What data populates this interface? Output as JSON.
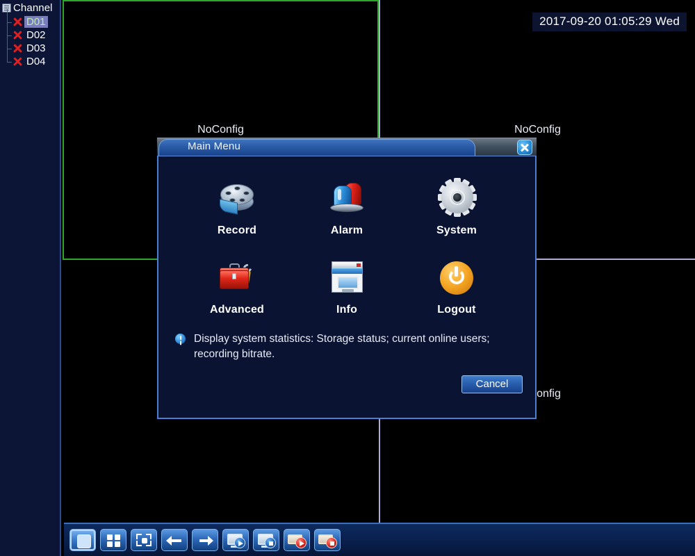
{
  "sidebar": {
    "header_label": "Channel",
    "header_icon": "tree-node-icon",
    "channels": [
      {
        "label": "D01",
        "status_icon": "red-x-icon",
        "selected": true
      },
      {
        "label": "D02",
        "status_icon": "red-x-icon",
        "selected": false
      },
      {
        "label": "D03",
        "status_icon": "red-x-icon",
        "selected": false
      },
      {
        "label": "D04",
        "status_icon": "red-x-icon",
        "selected": false
      }
    ]
  },
  "wall": {
    "osd_timestamp": "2017-09-20 01:05:29 Wed",
    "panes": [
      {
        "id": "pane-1",
        "status_text": "NoConfig",
        "selected": true
      },
      {
        "id": "pane-2",
        "status_text": "NoConfig",
        "selected": false
      },
      {
        "id": "pane-3",
        "status_text": "",
        "selected": false
      },
      {
        "id": "pane-4",
        "status_text": "NoConfig",
        "selected": false
      }
    ],
    "selection_color": "#2aa82a",
    "divider_color": "#b6a8d8"
  },
  "dialog": {
    "title": "Main Menu",
    "close_label": "✕",
    "items": [
      {
        "label": "Record",
        "icon": "film-reel-icon"
      },
      {
        "label": "Alarm",
        "icon": "siren-icon"
      },
      {
        "label": "System",
        "icon": "gear-icon"
      },
      {
        "label": "Advanced",
        "icon": "toolbox-icon"
      },
      {
        "label": "Info",
        "icon": "monitor-window-icon"
      },
      {
        "label": "Logout",
        "icon": "power-icon"
      }
    ],
    "hint_icon": "info-icon",
    "hint_text": "Display system statistics: Storage status; current online users; recording bitrate.",
    "cancel_label": "Cancel"
  },
  "taskbar": {
    "buttons": [
      {
        "name": "single-view-button",
        "icon": "single-pane-icon",
        "active": true
      },
      {
        "name": "quad-view-button",
        "icon": "quad-pane-icon",
        "active": false
      },
      {
        "name": "fullscreen-button",
        "icon": "fullscreen-icon",
        "active": false
      },
      {
        "name": "prev-page-button",
        "icon": "arrow-left-icon",
        "active": false
      },
      {
        "name": "next-page-button",
        "icon": "arrow-right-icon",
        "active": false
      },
      {
        "name": "start-tour-button",
        "icon": "monitor-play-icon",
        "active": false
      },
      {
        "name": "stop-tour-button",
        "icon": "monitor-stop-icon",
        "active": false
      },
      {
        "name": "start-record-button",
        "icon": "record-play-icon",
        "active": false
      },
      {
        "name": "stop-record-button",
        "icon": "record-stop-icon",
        "active": false
      }
    ]
  },
  "colors": {
    "accent_blue": "#2d68b8",
    "panel_bg": "#0b1333",
    "sidebar_bg": "#0c1535",
    "alarm_red": "#e0231b",
    "logout_orange": "#f5a623"
  }
}
